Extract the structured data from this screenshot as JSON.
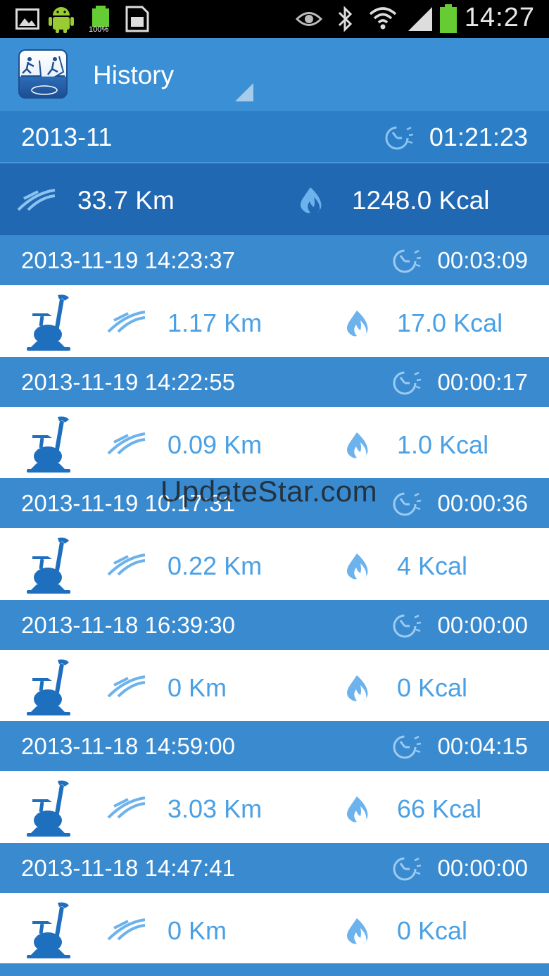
{
  "status_bar": {
    "time": "14:27",
    "battery_text": "100%",
    "icons": [
      "gallery-icon",
      "android-icon",
      "battery-icon",
      "sim-icon",
      "eye-icon",
      "bluetooth-icon",
      "wifi-icon",
      "signal-icon",
      "battery-full-icon"
    ]
  },
  "action_bar": {
    "title": "History",
    "logo_icon": "treadmill-bike-logo"
  },
  "summary": {
    "month": "2013-11",
    "total_time": "01:21:23",
    "total_distance": "33.7 Km",
    "total_calories": "1248.0 Kcal"
  },
  "entries": [
    {
      "datetime": "2013-11-19 14:23:37",
      "duration": "00:03:09",
      "distance": "1.17 Km",
      "calories": "17.0 Kcal"
    },
    {
      "datetime": "2013-11-19 14:22:55",
      "duration": "00:00:17",
      "distance": "0.09 Km",
      "calories": "1.0 Kcal"
    },
    {
      "datetime": "2013-11-19 10:17:31",
      "duration": "00:00:36",
      "distance": "0.22 Km",
      "calories": "4 Kcal"
    },
    {
      "datetime": "2013-11-18 16:39:30",
      "duration": "00:00:00",
      "distance": "0 Km",
      "calories": "0 Kcal"
    },
    {
      "datetime": "2013-11-18 14:59:00",
      "duration": "00:04:15",
      "distance": "3.03 Km",
      "calories": "66 Kcal"
    },
    {
      "datetime": "2013-11-18 14:47:41",
      "duration": "00:00:00",
      "distance": "0 Km",
      "calories": "0 Kcal"
    }
  ],
  "watermark": "UpdateStar.com",
  "colors": {
    "action_bar": "#3b8fd4",
    "summary_dark": "#2168b2",
    "entry_header": "#3a8ad0",
    "accent_text": "#4aa0e4"
  }
}
